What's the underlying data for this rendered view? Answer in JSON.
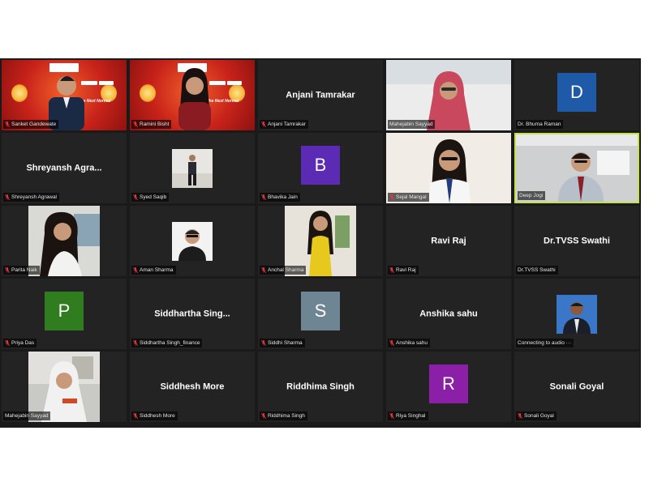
{
  "participants": [
    {
      "id": "p1",
      "name": "Sanket Gandewate",
      "muted": true,
      "kind": "banner",
      "person": "suit"
    },
    {
      "id": "p2",
      "name": "Ramini Bisht",
      "muted": true,
      "kind": "banner",
      "person": "woman"
    },
    {
      "id": "p3",
      "name": "Anjani Tamrakar",
      "display": "Anjani Tamrakar",
      "muted": true,
      "kind": "name"
    },
    {
      "id": "p4",
      "name": "Mahejabin Sayyad",
      "muted": false,
      "kind": "video",
      "person": "hijab"
    },
    {
      "id": "p5",
      "name": "Dr. Bhuma Raman",
      "muted": false,
      "kind": "avatar",
      "letter": "D",
      "color": "#1e5aa8"
    },
    {
      "id": "p6",
      "name": "Shreyansh Agrawal",
      "display": "Shreyansh  Agra...",
      "muted": true,
      "kind": "name"
    },
    {
      "id": "p7",
      "name": "Syed Saqib",
      "muted": true,
      "kind": "photo",
      "person": "standing"
    },
    {
      "id": "p8",
      "name": "Bhavika Jain",
      "muted": true,
      "kind": "avatar",
      "letter": "B",
      "color": "#5b2bb5"
    },
    {
      "id": "p9",
      "name": "Sejal Mangal",
      "muted": true,
      "kind": "video",
      "person": "girl"
    },
    {
      "id": "p10",
      "name": "Deep Jogi",
      "muted": false,
      "kind": "video",
      "person": "office",
      "active": true
    },
    {
      "id": "p11",
      "name": "Parita Naik",
      "muted": true,
      "kind": "photo",
      "person": "longhair"
    },
    {
      "id": "p12",
      "name": "Aman Sharma",
      "muted": true,
      "kind": "photo",
      "person": "man"
    },
    {
      "id": "p13",
      "name": "Anchal Sharma",
      "muted": true,
      "kind": "photo",
      "person": "yellow"
    },
    {
      "id": "p14",
      "name": "Ravi Raj",
      "display": "Ravi Raj",
      "muted": true,
      "kind": "name"
    },
    {
      "id": "p15",
      "name": "Dr.TVSS Swathi",
      "display": "Dr.TVSS Swathi",
      "muted": false,
      "kind": "name"
    },
    {
      "id": "p16",
      "name": "Priya Das",
      "muted": true,
      "kind": "avatar",
      "letter": "P",
      "color": "#2f7d1f"
    },
    {
      "id": "p17",
      "name": "Siddhartha Singh_finance",
      "display": "Siddhartha  Sing...",
      "muted": true,
      "kind": "name"
    },
    {
      "id": "p18",
      "name": "Siddhi Sharma",
      "muted": true,
      "kind": "avatar",
      "letter": "S",
      "color": "#6e8594"
    },
    {
      "id": "p19",
      "name": "Anshika sahu",
      "display": "Anshika sahu",
      "muted": true,
      "kind": "name"
    },
    {
      "id": "p20",
      "name": "Connecting to audio ···",
      "muted": false,
      "kind": "photo",
      "person": "blueman"
    },
    {
      "id": "p21",
      "name": "Mahejabin Sayyad",
      "muted": false,
      "kind": "photo",
      "person": "hijab2"
    },
    {
      "id": "p22",
      "name": "Siddhesh More",
      "display": "Siddhesh More",
      "muted": true,
      "kind": "name"
    },
    {
      "id": "p23",
      "name": "Riddhima Singh",
      "display": "Riddhima Singh",
      "muted": true,
      "kind": "name"
    },
    {
      "id": "p24",
      "name": "Riya Singhal",
      "muted": true,
      "kind": "avatar",
      "letter": "R",
      "color": "#8b1fa8"
    },
    {
      "id": "p25",
      "name": "Sonali Goyal",
      "display": "Sonali Goyal",
      "muted": true,
      "kind": "name"
    }
  ],
  "banner": {
    "line1": "the Next Normal"
  },
  "colors": {
    "mic_muted": "#e0383e",
    "active_border": "#c6e24b",
    "tile_bg": "#232323"
  }
}
